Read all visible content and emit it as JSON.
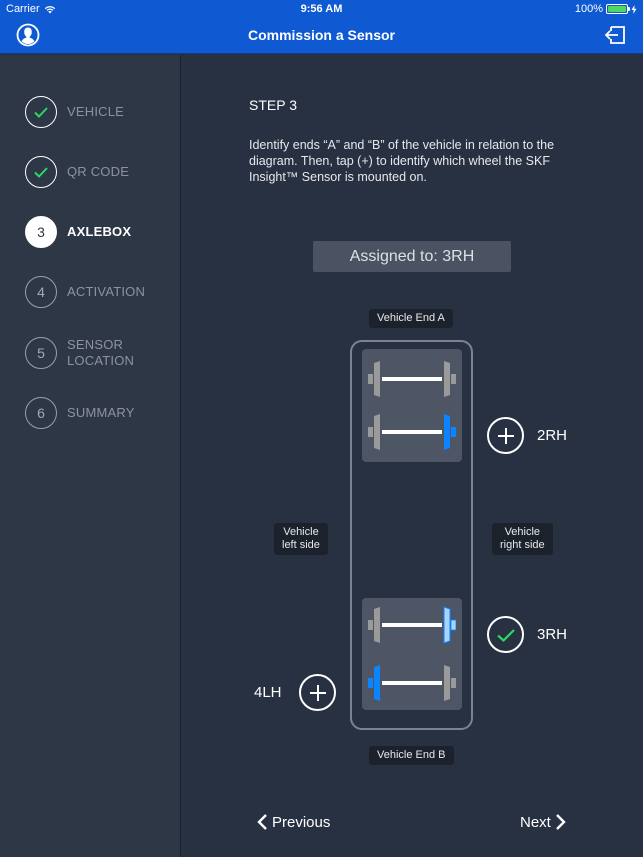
{
  "status_bar": {
    "carrier": "Carrier",
    "time": "9:56 AM",
    "battery": "100%"
  },
  "nav": {
    "title": "Commission a Sensor",
    "left_icon": "profile-icon",
    "right_icon": "logout-icon"
  },
  "steps": [
    {
      "number": "1",
      "label": "VEHICLE",
      "state": "done"
    },
    {
      "number": "2",
      "label": "QR CODE",
      "state": "done"
    },
    {
      "number": "3",
      "label": "AXLEBOX",
      "state": "active"
    },
    {
      "number": "4",
      "label": "ACTIVATION",
      "state": "pending"
    },
    {
      "number": "5",
      "label": "SENSOR LOCATION",
      "state": "pending"
    },
    {
      "number": "6",
      "label": "SUMMARY",
      "state": "pending"
    }
  ],
  "content": {
    "step_title": "STEP 3",
    "instructions": "Identify ends “A” and “B” of the vehicle in relation to the diagram. Then, tap (+) to identify which wheel the SKF Insight™ Sensor is mounted on.",
    "assigned": "Assigned to: 3RH"
  },
  "diagram": {
    "end_a": "Vehicle End A",
    "end_b": "Vehicle End B",
    "left_side": "Vehicle\nleft side",
    "right_side": "Vehicle\nright side",
    "wheels": [
      {
        "id": "2RH",
        "label": "2RH",
        "state": "add"
      },
      {
        "id": "3RH",
        "label": "3RH",
        "state": "assigned"
      },
      {
        "id": "4LH",
        "label": "4LH",
        "state": "add"
      }
    ]
  },
  "footer": {
    "previous": "Previous",
    "next": "Next"
  },
  "colors": {
    "nav_blue": "#0f5ad3",
    "wheel_highlight": "#0a84ff",
    "wheel_selected": "#a8d4ff",
    "check_green": "#2bd865"
  }
}
